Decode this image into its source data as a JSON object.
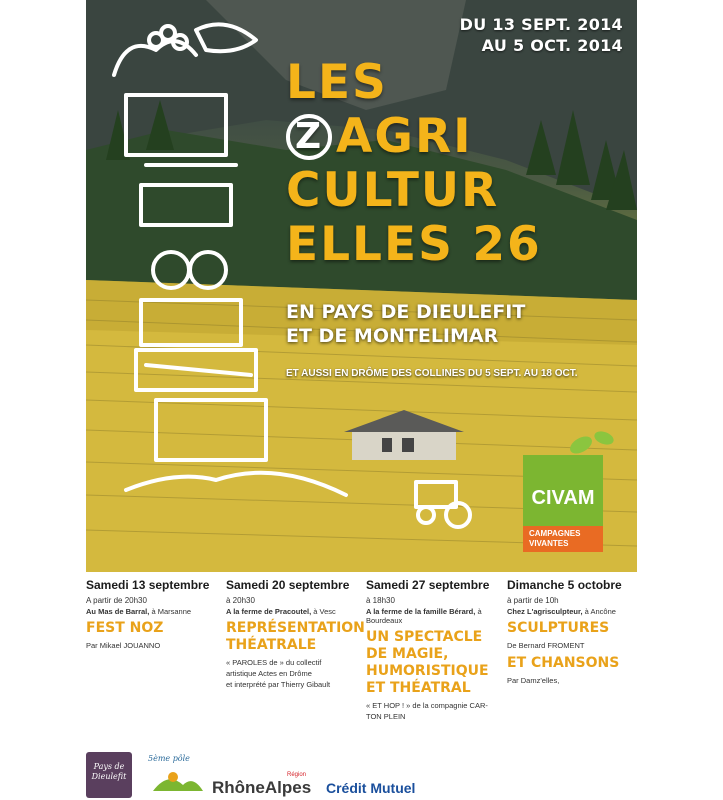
{
  "poster": {
    "dates": [
      "DU 13 SEPT. 2014",
      "AU 5 OCT. 2014"
    ],
    "title": {
      "line1": "LES",
      "line2_circle": "Z",
      "line2_rest": "AGRI",
      "line3": "CULTUR",
      "line4": "ELLES 26"
    },
    "subtitle": [
      "EN PAYS DE DIEULEFIT",
      "ET DE MONTELIMAR"
    ],
    "also": "ET AUSSI EN DRÔME DES COLLINES DU 5 SEPT. AU 18 OCT.",
    "civam": {
      "name": "CIVAM",
      "tagline": [
        "CAMPAGNES",
        "VIVANTES"
      ]
    }
  },
  "events": [
    {
      "date": "Samedi 13 septembre",
      "time": "A partir de 20h30",
      "place_bold": "Au Mas de Barral,",
      "place_rest": " à Marsanne",
      "title": [
        "FEST NOZ"
      ],
      "by": [
        "Par Mikael JOUANNO"
      ]
    },
    {
      "date": "Samedi 20 septembre",
      "time": "à 20h30",
      "place_bold": "A la ferme de Pracoutel,",
      "place_rest": " à Vesc",
      "title": [
        "REPRÉSENTATION",
        "THÉATRALE"
      ],
      "by": [
        "« PAROLES de » du collectif",
        "artistique Actes en Drôme",
        "et interprété par Thierry Gibault"
      ]
    },
    {
      "date": "Samedi 27 septembre",
      "time": "à 18h30",
      "place_bold": "A la ferme de la famille Bérard,",
      "place_rest": " à Bourdeaux",
      "title": [
        "UN SPECTACLE",
        "DE MAGIE,",
        "HUMORISTIQUE",
        "ET THÉATRAL"
      ],
      "by": [
        "« ET HOP ! » de la compagnie CAR-",
        "TON PLEIN"
      ]
    },
    {
      "date": "Dimanche 5 octobre",
      "time": "à partir de 10h",
      "place_bold": "Chez L'agrisculpteur,",
      "place_rest": " à Ancône",
      "title": [
        "SCULPTURES"
      ],
      "by": [
        "De Bernard FROMENT"
      ],
      "title2": [
        "ET CHANSONS"
      ],
      "by2": [
        "Par Damz'elles,"
      ]
    }
  ],
  "logos": {
    "dieulefit": [
      "Pays de",
      "Dieulefit"
    ],
    "pole": "5ème pôle",
    "rhonealpes": "RhôneAlpes",
    "rhonealpes_small": "Région",
    "credit_mutuel": "Crédit Mutuel"
  },
  "colors": {
    "title_yellow": "#f4b41a",
    "event_title": "#e9a21a",
    "civam_green": "#7cb631",
    "civam_orange": "#e96b23",
    "credit_blue": "#1a4f9c",
    "credit_red": "#d5232a"
  }
}
